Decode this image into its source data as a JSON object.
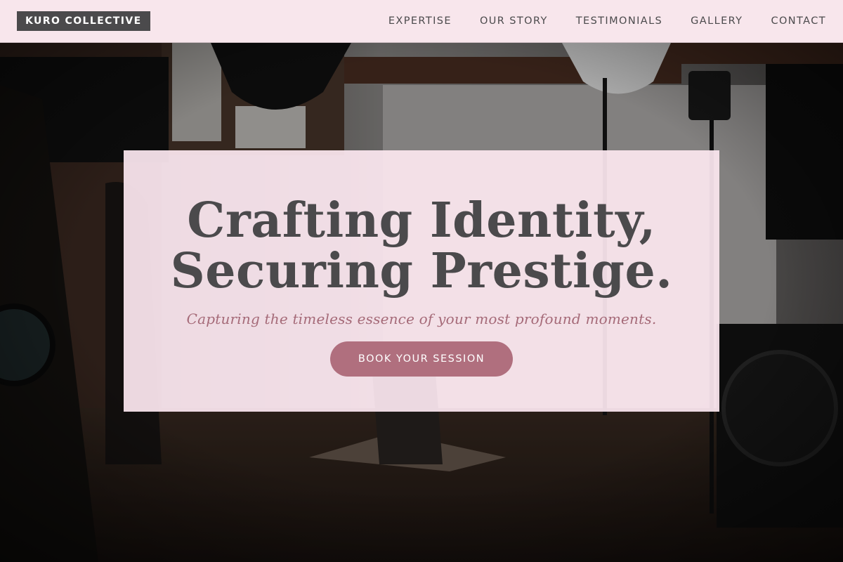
{
  "brand": {
    "name": "KURO COLLECTIVE"
  },
  "nav": {
    "items": [
      {
        "label": "EXPERTISE"
      },
      {
        "label": "OUR STORY"
      },
      {
        "label": "TESTIMONIALS"
      },
      {
        "label": "GALLERY"
      },
      {
        "label": "CONTACT"
      }
    ]
  },
  "hero": {
    "headline_line1": "Crafting Identity,",
    "headline_line2": "Securing Prestige.",
    "tagline": "Capturing the timeless essence of your most profound moments.",
    "cta_label": "BOOK YOUR SESSION",
    "background_image": "photography-studio-photo"
  },
  "colors": {
    "header_bg": "#f8e6ec",
    "logo_bg": "#4b4a4c",
    "text_dark": "#4b4a4c",
    "accent": "#b06f7e",
    "tagline": "#a56a78"
  }
}
